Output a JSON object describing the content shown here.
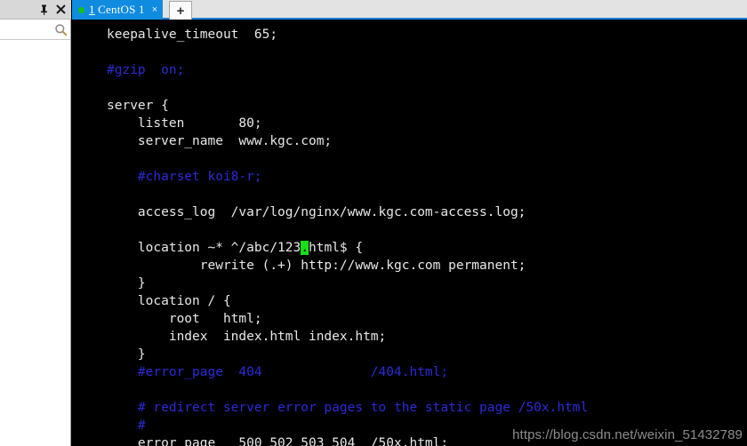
{
  "sidebar": {
    "pin_icon": "pin-icon",
    "close_icon": "close-icon",
    "search_icon": "search-icon",
    "search_value": "",
    "search_placeholder": ""
  },
  "tabbar": {
    "active_tab": {
      "accel": "1",
      "title": " CentOS 1",
      "full_label": "1 CentOS 1",
      "status_dot_color": "#14c217",
      "close_label": "×"
    },
    "new_tab_label": "+",
    "accent_color": "#0f8ce0",
    "underline_color": "#1a7fd4"
  },
  "terminal": {
    "background": "#000000",
    "foreground": "#e8e8e8",
    "comment_color": "#2b2bd6",
    "cursor_color": "#16e016",
    "cursor_char": ".",
    "lines": [
      {
        "text": "keepalive_timeout  65;",
        "type": "code"
      },
      {
        "text": "",
        "type": "code"
      },
      {
        "text": "#gzip  on;",
        "type": "comment"
      },
      {
        "text": "",
        "type": "code"
      },
      {
        "text": "server {",
        "type": "code"
      },
      {
        "text": "    listen       80;",
        "type": "code"
      },
      {
        "text": "    server_name  www.kgc.com;",
        "type": "code"
      },
      {
        "text": "",
        "type": "code"
      },
      {
        "text": "    #charset koi8-r;",
        "type": "comment"
      },
      {
        "text": "",
        "type": "code"
      },
      {
        "text": "    access_log  /var/log/nginx/www.kgc.com-access.log;",
        "type": "code"
      },
      {
        "text": "",
        "type": "code"
      },
      {
        "text": "    location ~* ^/abc/123.html$ {",
        "type": "cursor-line",
        "cursor_index": 25
      },
      {
        "text": "            rewrite (.+) http://www.kgc.com permanent;",
        "type": "code"
      },
      {
        "text": "    }",
        "type": "code"
      },
      {
        "text": "    location / {",
        "type": "code"
      },
      {
        "text": "        root   html;",
        "type": "code"
      },
      {
        "text": "        index  index.html index.htm;",
        "type": "code"
      },
      {
        "text": "    }",
        "type": "code"
      },
      {
        "text": "    #error_page  404              /404.html;",
        "type": "comment"
      },
      {
        "text": "",
        "type": "code"
      },
      {
        "text": "    # redirect server error pages to the static page /50x.html",
        "type": "comment"
      },
      {
        "text": "    #",
        "type": "comment"
      },
      {
        "text": "    error_page   500 502 503 504  /50x.html;",
        "type": "code"
      }
    ]
  },
  "watermark": {
    "text": "https://blog.csdn.net/weixin_51432789"
  }
}
